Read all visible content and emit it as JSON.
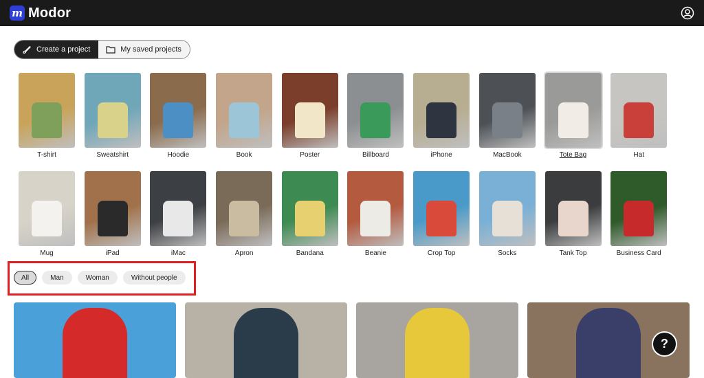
{
  "app": {
    "name": "Modor",
    "logo_glyph": "m"
  },
  "header": {
    "account_icon": "user-circle-icon"
  },
  "tabs": [
    {
      "label": "Create a project",
      "icon": "brush-icon",
      "active": true
    },
    {
      "label": "My saved projects",
      "icon": "folder-icon",
      "active": false
    }
  ],
  "products": [
    {
      "label": "T-shirt",
      "bg": "#c9a35a",
      "fg": "#7fa05b"
    },
    {
      "label": "Sweatshirt",
      "bg": "#6fa6b8",
      "fg": "#d8d28a"
    },
    {
      "label": "Hoodie",
      "bg": "#8a6b4c",
      "fg": "#4c8fc4"
    },
    {
      "label": "Book",
      "bg": "#c2a58a",
      "fg": "#9cc6d8"
    },
    {
      "label": "Poster",
      "bg": "#7a3e2a",
      "fg": "#f2e6c8"
    },
    {
      "label": "Billboard",
      "bg": "#8c8f91",
      "fg": "#3a9a5a"
    },
    {
      "label": "iPhone",
      "bg": "#b7ad90",
      "fg": "#2e3440"
    },
    {
      "label": "MacBook",
      "bg": "#4d5156",
      "fg": "#7a8088"
    },
    {
      "label": "Tote Bag",
      "bg": "#9a9a98",
      "fg": "#f1ece6",
      "underline": true
    },
    {
      "label": "Hat",
      "bg": "#c7c5c1",
      "fg": "#c9403a"
    },
    {
      "label": "Mug",
      "bg": "#d8d3c8",
      "fg": "#f4f2ee"
    },
    {
      "label": "iPad",
      "bg": "#a0714a",
      "fg": "#2a2a2a"
    },
    {
      "label": "iMac",
      "bg": "#3c3f43",
      "fg": "#e8e8e8"
    },
    {
      "label": "Apron",
      "bg": "#7a6a58",
      "fg": "#c9bca0"
    },
    {
      "label": "Bandana",
      "bg": "#3d8a52",
      "fg": "#e7d070"
    },
    {
      "label": "Beanie",
      "bg": "#b45a3f",
      "fg": "#ecebe6"
    },
    {
      "label": "Crop Top",
      "bg": "#4a9ac9",
      "fg": "#d94a3a"
    },
    {
      "label": "Socks",
      "bg": "#7ab0d6",
      "fg": "#e6e0d6"
    },
    {
      "label": "Tank Top",
      "bg": "#3a3c3e",
      "fg": "#e8d6cc"
    },
    {
      "label": "Business Card",
      "bg": "#2f5a2a",
      "fg": "#c72a2a"
    }
  ],
  "filters": [
    {
      "label": "All",
      "active": true
    },
    {
      "label": "Man",
      "active": false
    },
    {
      "label": "Woman",
      "active": false
    },
    {
      "label": "Without people",
      "active": false
    }
  ],
  "gallery": [
    {
      "bg": "#4aa0d8",
      "fg": "#d42a2a"
    },
    {
      "bg": "#b8b2a6",
      "fg": "#2a3c4a"
    },
    {
      "bg": "#a8a4a0",
      "fg": "#e6c83a"
    },
    {
      "bg": "#8a735e",
      "fg": "#3a3f6a"
    }
  ],
  "help": {
    "label": "?",
    "icon": "help-icon"
  }
}
